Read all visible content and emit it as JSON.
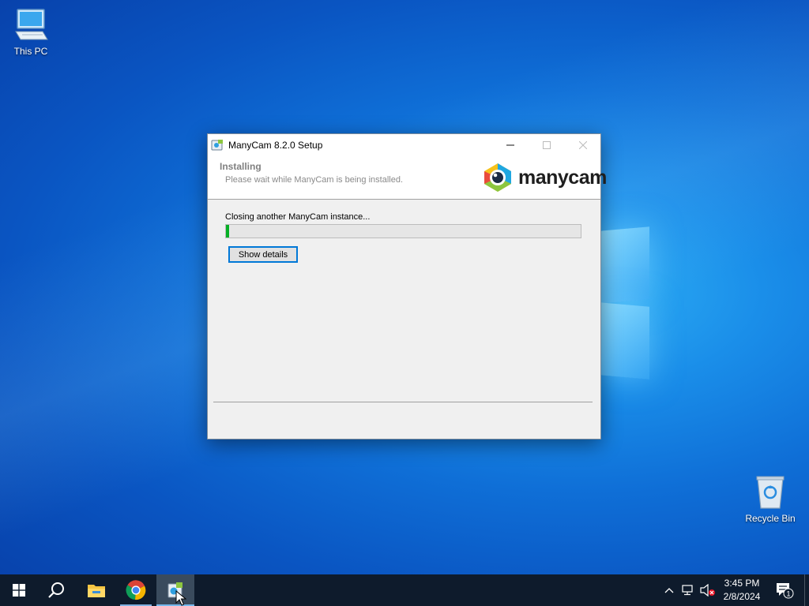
{
  "desktop": {
    "icons": [
      {
        "label": "This PC"
      },
      {
        "label": "Recycle Bin"
      }
    ]
  },
  "setup_window": {
    "title": "ManyCam 8.2.0 Setup",
    "header_title": "Installing",
    "header_subtitle": "Please wait while ManyCam is being installed.",
    "brand_name": "manycam",
    "status_text": "Closing another ManyCam instance...",
    "progress_fraction": 0.01,
    "show_details_label": "Show details",
    "accent_color": "#06b025"
  },
  "taskbar": {
    "apps": [
      {
        "icon": "windows-start-icon"
      },
      {
        "icon": "search-icon"
      },
      {
        "icon": "file-explorer-icon"
      },
      {
        "icon": "chrome-icon"
      },
      {
        "icon": "setup-installer-icon",
        "active": true
      }
    ],
    "clock": {
      "time": "3:45 PM",
      "date": "2/8/2024"
    },
    "notification_count": "1"
  }
}
